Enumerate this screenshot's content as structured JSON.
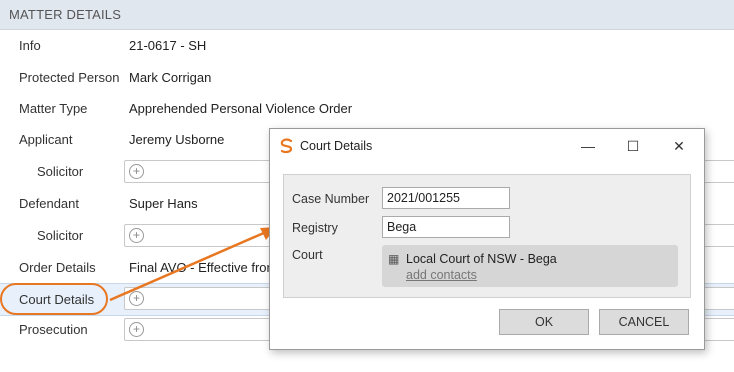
{
  "header": {
    "title": "MATTER DETAILS"
  },
  "rows": [
    {
      "label": "Info",
      "value": "21-0617 - SH"
    },
    {
      "label": "Protected Person",
      "value": "Mark Corrigan"
    },
    {
      "label": "Matter Type",
      "value": "Apprehended Personal Violence Order"
    },
    {
      "label": "Applicant",
      "value": "Jeremy Usborne"
    },
    {
      "label": "Solicitor",
      "value": ""
    },
    {
      "label": "Defendant",
      "value": "Super Hans"
    },
    {
      "label": "Solicitor",
      "value": ""
    },
    {
      "label": "Order Details",
      "value": "Final AVO - Effective from"
    },
    {
      "label": "Court Details",
      "value": ""
    },
    {
      "label": "Prosecution",
      "value": ""
    }
  ],
  "dialog": {
    "title": "Court Details",
    "case_number_label": "Case Number",
    "case_number_value": "2021/001255",
    "registry_label": "Registry",
    "registry_value": "Bega",
    "court_label": "Court",
    "court_name": "Local Court of NSW - Bega",
    "add_contacts": "add contacts",
    "ok_label": "OK",
    "cancel_label": "CANCEL"
  },
  "icons": {
    "add": "plus-circle-icon",
    "building": "building-icon",
    "logo": "app-logo-icon"
  },
  "colors": {
    "accent": "#e87722",
    "header_bg": "#e1e7ef",
    "selected_row": "#e8f0fb"
  }
}
